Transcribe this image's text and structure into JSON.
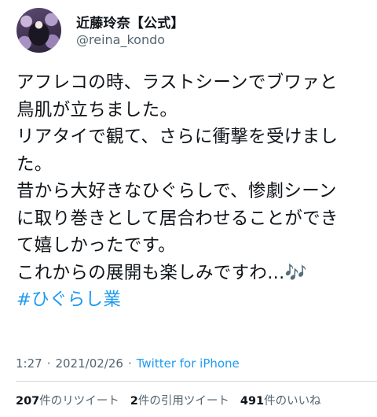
{
  "user": {
    "display_name": "近藤玲奈【公式】",
    "handle": "@reina_kondo"
  },
  "tweet": {
    "lines": [
      "アフレコの時、ラストシーンでブワァと",
      "鳥肌が立ちました。",
      "リアタイで観て、さらに衝撃を受けまし",
      "た。",
      "昔から大好きなひぐらしで、惨劇シーン",
      "に取り巻きとして居合わせることができ",
      "て嬉しかったです。",
      "これからの展開も楽しみですわ...🎶"
    ],
    "hashtag": "#ひぐらし業"
  },
  "meta": {
    "time": "1:27",
    "separator": "·",
    "date": "2021/02/26",
    "separator2": "·",
    "source": "Twitter for iPhone"
  },
  "stats": {
    "retweets_count": "207",
    "retweets_label": "件のリツイート",
    "quotes_count": "2",
    "quotes_label": "件の引用ツイート",
    "likes_count": "491",
    "likes_label": "件のいいね"
  }
}
